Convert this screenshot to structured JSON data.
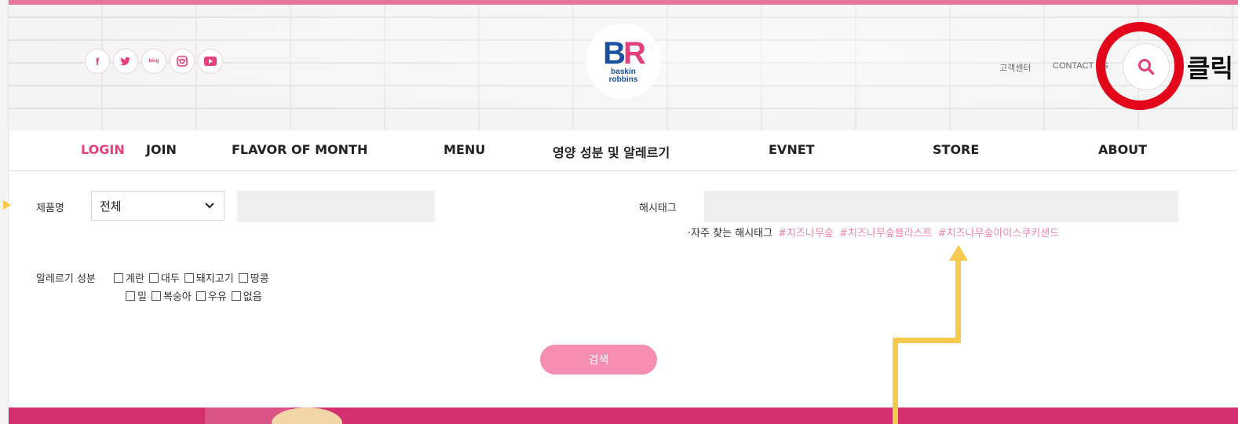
{
  "header": {
    "social": [
      {
        "name": "facebook",
        "text": "f"
      },
      {
        "name": "twitter",
        "text": ""
      },
      {
        "name": "blog",
        "text": "blog"
      },
      {
        "name": "instagram",
        "text": ""
      },
      {
        "name": "youtube",
        "text": ""
      }
    ],
    "logo": {
      "mark_b": "B",
      "mark_r": "R",
      "line1": "baskin",
      "line2": "robbins"
    },
    "customer_center": "고객센터",
    "contact_us": "CONTACT US",
    "click_annotation": "클릭"
  },
  "nav": {
    "login": "LOGIN",
    "join": "JOIN",
    "items": [
      "FLAVOR OF MONTH",
      "MENU",
      "영양 성분 및 알레르기",
      "EVNET",
      "STORE",
      "ABOUT"
    ]
  },
  "form": {
    "product_label": "제품명",
    "product_select": "전체",
    "hashtag_label": "해시태그",
    "frequent_label": "·자주 찾는 해시태그",
    "frequent_tags": [
      "#치즈나무숲",
      "#치즈나무숲블라스트",
      "#치즈나무숲아이스쿠키샌드"
    ],
    "allergy_label": "알레르기 성분",
    "allergy_row1": [
      "계란",
      "대두",
      "돼지고기",
      "땅콩"
    ],
    "allergy_row2": [
      "밀",
      "복숭아",
      "우유",
      "없음"
    ],
    "search_button": "검색"
  },
  "colors": {
    "brand_pink": "#e5407d",
    "band_pink": "#d42f6e",
    "button_pink": "#f58eb0",
    "annotation_red": "#e3061a",
    "annotation_yellow": "#f7c94f"
  }
}
